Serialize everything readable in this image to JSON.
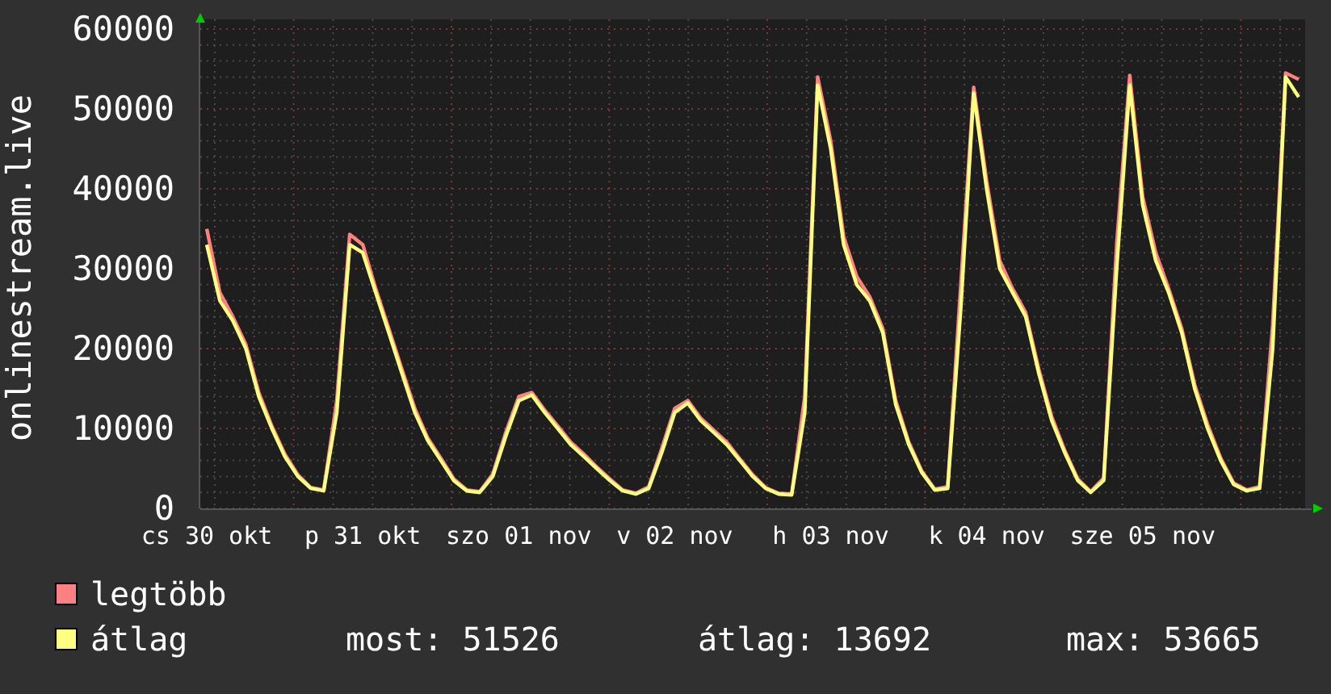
{
  "chart_data": {
    "type": "line",
    "grid": true,
    "ylabel": "onlinestream.live",
    "ylim": [
      0,
      60000
    ],
    "yticks": [
      0,
      10000,
      20000,
      30000,
      40000,
      50000,
      60000
    ],
    "categories": [
      "cs 30 okt",
      null,
      null,
      null,
      null,
      null,
      null,
      null,
      null,
      null,
      null,
      null,
      "p 31 okt",
      null,
      null,
      null,
      null,
      null,
      null,
      null,
      null,
      null,
      null,
      null,
      "szo 01 nov",
      null,
      null,
      null,
      null,
      null,
      null,
      null,
      null,
      null,
      null,
      null,
      "v 02 nov",
      null,
      null,
      null,
      null,
      null,
      null,
      null,
      null,
      null,
      null,
      null,
      "h 03 nov",
      null,
      null,
      null,
      null,
      null,
      null,
      null,
      null,
      null,
      null,
      null,
      "k 04 nov",
      null,
      null,
      null,
      null,
      null,
      null,
      null,
      null,
      null,
      null,
      null,
      "sze 05 nov",
      null,
      null,
      null,
      null,
      null,
      null,
      null,
      null,
      null,
      null,
      null,
      null
    ],
    "series": [
      {
        "name": "legtöbb",
        "color": "#ff8080",
        "values": [
          35000,
          27000,
          24000,
          20500,
          14500,
          10300,
          6800,
          4200,
          2600,
          2300,
          13500,
          34300,
          33000,
          27500,
          22500,
          17500,
          12500,
          8800,
          6300,
          3700,
          2300,
          2100,
          4300,
          9500,
          14000,
          14500,
          12300,
          10300,
          8300,
          6800,
          5200,
          3700,
          2300,
          1900,
          2700,
          7500,
          12500,
          13500,
          11300,
          9800,
          8300,
          6200,
          4200,
          2600,
          1900,
          1800,
          14000,
          54000,
          46000,
          34000,
          29000,
          26500,
          22500,
          13500,
          8300,
          4700,
          2400,
          2700,
          28000,
          52700,
          41000,
          31000,
          27500,
          24500,
          17500,
          11500,
          7300,
          3700,
          2100,
          3800,
          33000,
          54200,
          39000,
          32000,
          27500,
          22500,
          15500,
          10500,
          6300,
          3200,
          2300,
          2700,
          23000,
          54500,
          53700
        ]
      },
      {
        "name": "átlag",
        "color": "#ffff80",
        "values": [
          33000,
          26000,
          23500,
          20000,
          14000,
          10000,
          6500,
          4000,
          2500,
          2200,
          12000,
          33000,
          32000,
          27000,
          22000,
          17000,
          12000,
          8500,
          6000,
          3500,
          2200,
          2000,
          4000,
          9000,
          13500,
          14200,
          12000,
          10000,
          8000,
          6500,
          5000,
          3500,
          2200,
          1800,
          2500,
          7000,
          12000,
          13200,
          11000,
          9500,
          8000,
          6000,
          4000,
          2500,
          1800,
          1700,
          12000,
          53000,
          45000,
          33000,
          28000,
          26000,
          22000,
          13000,
          8000,
          4500,
          2300,
          2500,
          25000,
          52000,
          40000,
          30000,
          27000,
          24000,
          17000,
          11000,
          7000,
          3500,
          2000,
          3500,
          30000,
          53000,
          38000,
          31000,
          27000,
          22000,
          15000,
          10000,
          6000,
          3000,
          2200,
          2500,
          20000,
          54000,
          51500
        ]
      }
    ]
  },
  "legend": {
    "stats": [
      "most: 51526",
      "átlag: 13692",
      "max: 53665"
    ]
  }
}
